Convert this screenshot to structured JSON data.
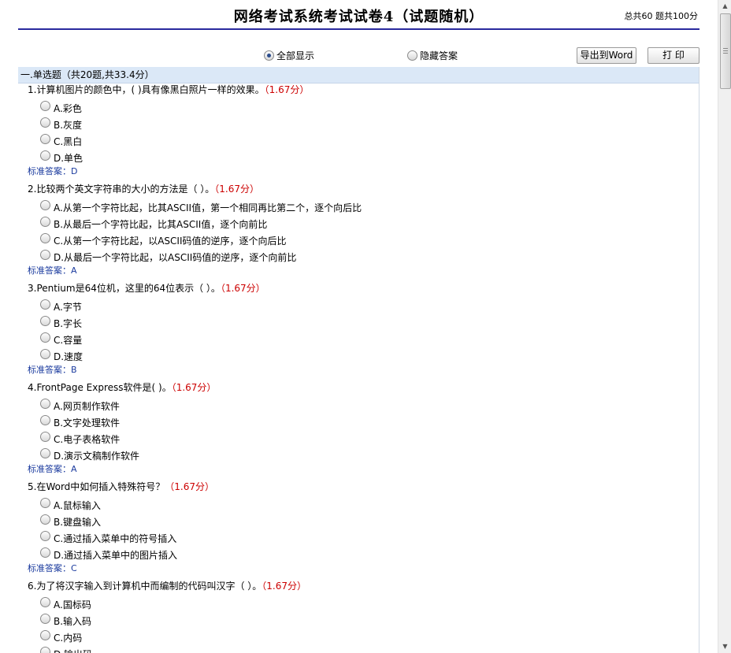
{
  "header": {
    "title": "网络考试系统考试试卷4（试题随机）",
    "stats": "总共60 题共100分"
  },
  "controls": {
    "show_all": "全部显示",
    "hide_answer": "隐藏答案",
    "export_word": "导出到Word",
    "print": "打 印"
  },
  "section": {
    "title": "一.单选题（共20题,共33.4分）"
  },
  "answer_label": "标准答案：",
  "questions": [
    {
      "text": "1.计算机图片的颜色中，( )具有像黑白照片一样的效果。",
      "score": "（1.67分）",
      "options": [
        "A.彩色",
        "B.灰度",
        "C.黑白",
        "D.单色"
      ],
      "answer": "D"
    },
    {
      "text": "2.比较两个英文字符串的大小的方法是（ ）。",
      "score": "（1.67分）",
      "options": [
        "A.从第一个字符比起，比其ASCII值，第一个相同再比第二个，逐个向后比",
        "B.从最后一个字符比起，比其ASCII值，逐个向前比",
        "C.从第一个字符比起，以ASCII码值的逆序，逐个向后比",
        "D.从最后一个字符比起，以ASCII码值的逆序，逐个向前比"
      ],
      "answer": "A"
    },
    {
      "text": "3.Pentium是64位机，这里的64位表示（ ）。",
      "score": "（1.67分）",
      "options": [
        "A.字节",
        "B.字长",
        "C.容量",
        "D.速度"
      ],
      "answer": "B"
    },
    {
      "text": "4.FrontPage Express软件是( )。",
      "score": "（1.67分）",
      "options": [
        "A.网页制作软件",
        "B.文字处理软件",
        "C.电子表格软件",
        "D.演示文稿制作软件"
      ],
      "answer": "A"
    },
    {
      "text": "5.在Word中如何插入特殊符号？",
      "score": "（1.67分）",
      "options": [
        "A.鼠标输入",
        "B.键盘输入",
        "C.通过插入菜单中的符号插入",
        "D.通过插入菜单中的图片插入"
      ],
      "answer": "C"
    },
    {
      "text": "6.为了将汉字输入到计算机中而编制的代码叫汉字（ ）。",
      "score": "（1.67分）",
      "options": [
        "A.国标码",
        "B.输入码",
        "C.内码",
        "D.输出码"
      ],
      "answer": ""
    }
  ]
}
